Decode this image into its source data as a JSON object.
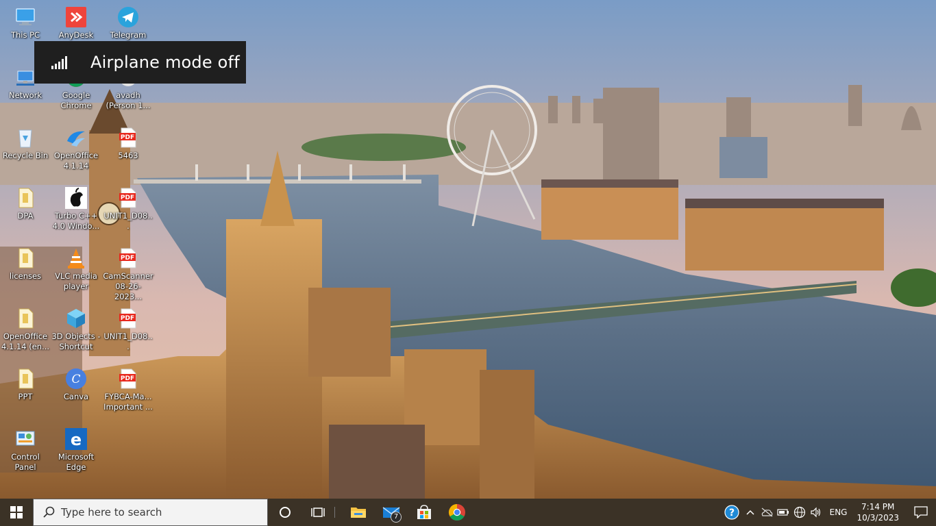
{
  "toast": {
    "text": "Airplane mode off",
    "icon": "signal-bars-icon"
  },
  "desktop_icons": [
    {
      "id": "this-pc",
      "label": "This PC",
      "icon": "computer-icon"
    },
    {
      "id": "anydesk",
      "label": "AnyDesk",
      "icon": "anydesk-icon"
    },
    {
      "id": "telegram",
      "label": "Telegram",
      "icon": "telegram-icon"
    },
    {
      "id": "network",
      "label": "Network",
      "icon": "network-icon"
    },
    {
      "id": "google-chrome",
      "label": "Google Chrome",
      "icon": "chrome-icon"
    },
    {
      "id": "avadh",
      "label": "avadh (Person 1...",
      "icon": "chrome-profile-icon"
    },
    {
      "id": "recycle-bin",
      "label": "Recycle Bin",
      "icon": "recycle-bin-icon"
    },
    {
      "id": "openoffice",
      "label": "OpenOffice 4.1.14",
      "icon": "openoffice-icon"
    },
    {
      "id": "pdf-5463",
      "label": "5463",
      "icon": "pdf-icon"
    },
    {
      "id": "dpa",
      "label": "DPA",
      "icon": "document-icon"
    },
    {
      "id": "turbo-cpp",
      "label": "Turbo C++ 4.0 Windo...",
      "icon": "apple-icon"
    },
    {
      "id": "unit1-a",
      "label": "UNIT1_D08...",
      "icon": "pdf-icon"
    },
    {
      "id": "licenses",
      "label": "licenses",
      "icon": "document-icon"
    },
    {
      "id": "vlc",
      "label": "VLC media player",
      "icon": "vlc-icon"
    },
    {
      "id": "camscanner",
      "label": "CamScanner 08-26-2023...",
      "icon": "pdf-icon"
    },
    {
      "id": "openoffice-en",
      "label": "OpenOffice 4.1.14 (en...",
      "icon": "document-icon"
    },
    {
      "id": "3d-objects",
      "label": "3D Objects - Shortcut",
      "icon": "3d-objects-icon"
    },
    {
      "id": "unit1-b",
      "label": "UNIT1_D08...",
      "icon": "pdf-icon"
    },
    {
      "id": "ppt",
      "label": "PPT",
      "icon": "document-icon"
    },
    {
      "id": "canva",
      "label": "Canva",
      "icon": "canva-icon"
    },
    {
      "id": "fybca",
      "label": "FYBCA-Ma... Important ...",
      "icon": "pdf-icon"
    },
    {
      "id": "control-panel",
      "label": "Control Panel",
      "icon": "control-panel-icon"
    },
    {
      "id": "edge",
      "label": "Microsoft Edge",
      "icon": "edge-icon"
    }
  ],
  "pdf_badge": "PDF",
  "taskbar": {
    "search_placeholder": "Type here to search",
    "pinned": [
      {
        "id": "file-explorer",
        "icon": "folder-icon"
      },
      {
        "id": "mail",
        "icon": "mail-icon",
        "badge": "7"
      },
      {
        "id": "store",
        "icon": "store-icon"
      },
      {
        "id": "chrome",
        "icon": "chrome-icon"
      }
    ],
    "language": "ENG",
    "time": "7:14 PM",
    "date": "10/3/2023"
  }
}
